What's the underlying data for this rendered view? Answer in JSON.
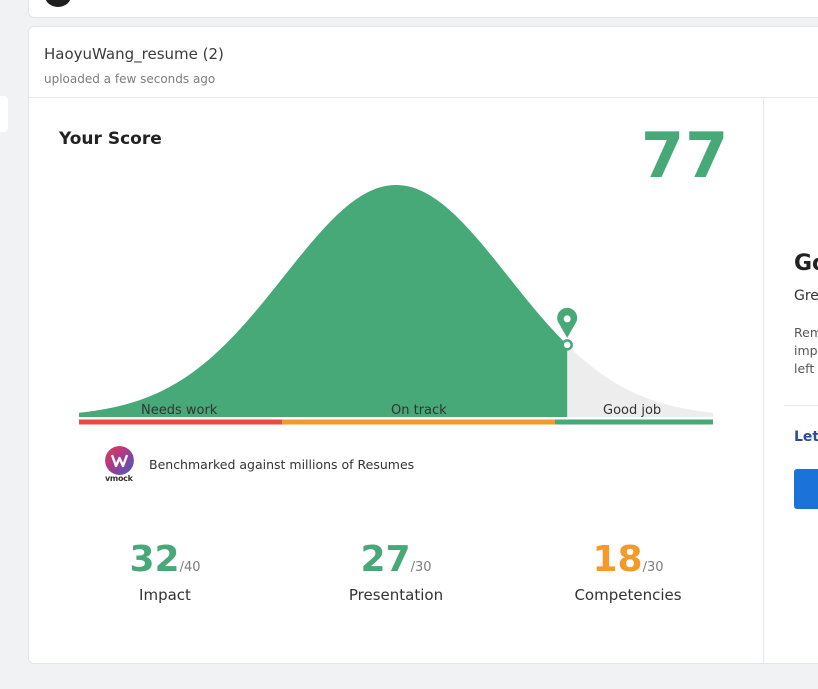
{
  "file": {
    "name": "HaoyuWang_resume (2)",
    "uploaded": "uploaded a few seconds ago"
  },
  "score": {
    "title": "Your Score",
    "value": "77",
    "marker_percentile": 0.77
  },
  "bands": [
    {
      "label": "Needs work",
      "color": "#e84c3d"
    },
    {
      "label": "On track",
      "color": "#f39a2b"
    },
    {
      "label": "Good job",
      "color": "#47a878"
    }
  ],
  "colors": {
    "accent_green": "#47a878",
    "accent_orange": "#f39a2b",
    "tail_gray": "#ededed",
    "link_blue": "#2b4c9a",
    "button_blue": "#1a73d9"
  },
  "benchmark": {
    "logo_text": "vmock",
    "text": "Benchmarked against millions of Resumes"
  },
  "metrics": [
    {
      "value": "32",
      "max": "/40",
      "label": "Impact",
      "color": "#47a878"
    },
    {
      "value": "27",
      "max": "/30",
      "label": "Presentation",
      "color": "#47a878"
    },
    {
      "value": "18",
      "max": "/30",
      "label": "Competencies",
      "color": "#f39a2b"
    }
  ],
  "right_panel": {
    "title": "Go",
    "subtitle": "Gre",
    "body": "Rem\nimp\nleft",
    "link": "Let"
  },
  "icons": {
    "marker": "map-pin-icon",
    "logo": "vmock-logo-icon"
  }
}
